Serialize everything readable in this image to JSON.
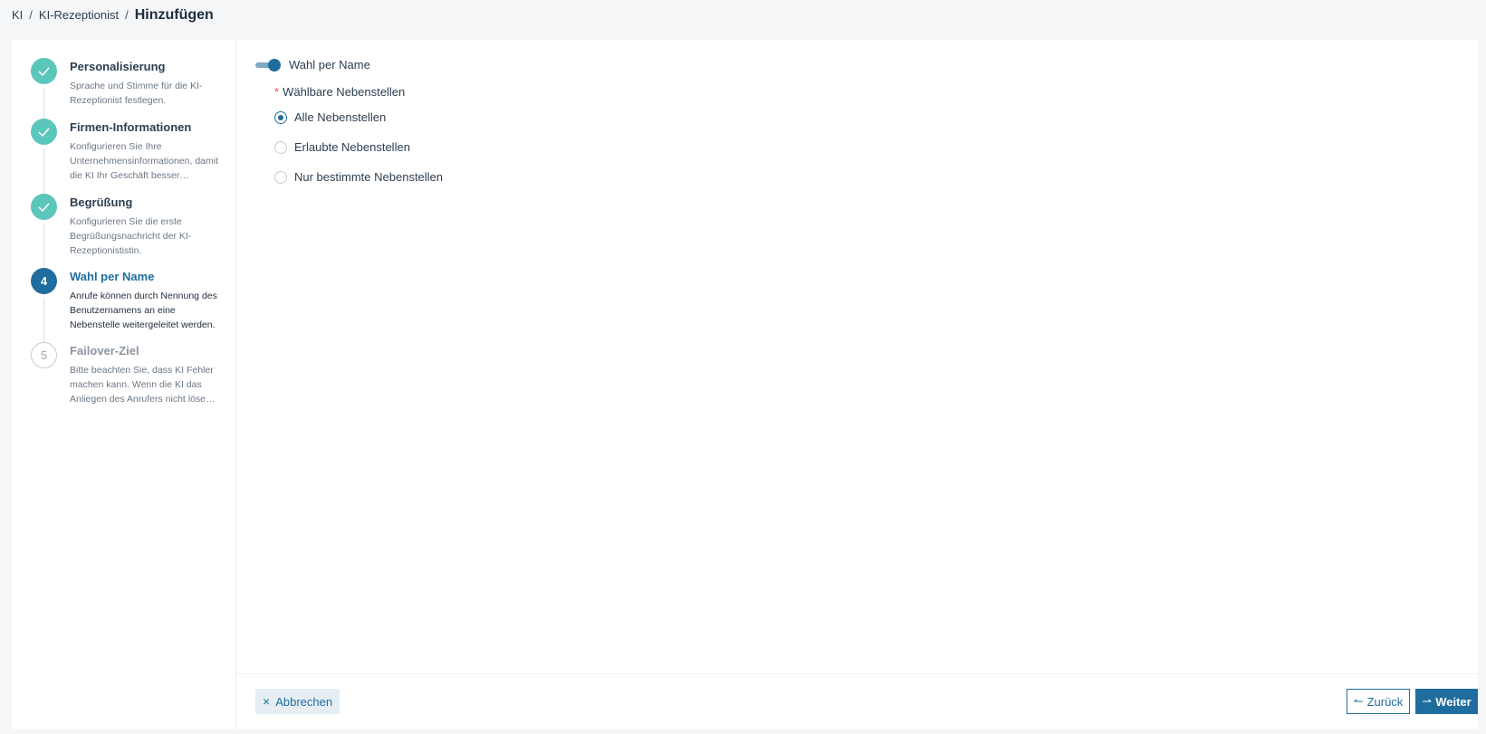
{
  "breadcrumb": {
    "items": [
      "KI",
      "KI-Rezeptionist"
    ],
    "separator": "/",
    "current": "Hinzufügen"
  },
  "steps": [
    {
      "number": "1",
      "status": "done",
      "title": "Personalisierung",
      "description": "Sprache und Stimme für die KI-Rezeptionist festlegen."
    },
    {
      "number": "2",
      "status": "done",
      "title": "Firmen-Informationen",
      "description": "Konfigurieren Sie Ihre Unternehmensinformationen, damit die KI Ihr Geschäft besser…"
    },
    {
      "number": "3",
      "status": "done",
      "title": "Begrüßung",
      "description": "Konfigurieren Sie die erste Begrüßungsnachricht der KI-Rezeptionististin."
    },
    {
      "number": "4",
      "status": "active",
      "title": "Wahl per Name",
      "description": "Anrufe können durch Nennung des Benutzernamens an eine Nebenstelle weitergeleitet werden."
    },
    {
      "number": "5",
      "status": "todo",
      "title": "Failover-Ziel",
      "description": "Bitte beachten Sie, dass KI Fehler machen kann. Wenn die KI das Anliegen des Anrufers nicht löse…"
    }
  ],
  "form": {
    "toggle_label": "Wahl per Name",
    "toggle_on": true,
    "required_mark": "*",
    "field_label": "Wählbare Nebenstellen",
    "options": [
      {
        "label": "Alle Nebenstellen",
        "checked": true
      },
      {
        "label": "Erlaubte Nebenstellen",
        "checked": false
      },
      {
        "label": "Nur bestimmte Nebenstellen",
        "checked": false
      }
    ]
  },
  "footer": {
    "cancel_icon": "×",
    "cancel_label": "Abbrechen",
    "back_icon": "↼",
    "back_label": "Zurück",
    "next_icon": "⇀",
    "next_label": "Weiter"
  },
  "colors": {
    "accent": "#1e6d9e",
    "done": "#5bc6bb",
    "required": "#e05a4b"
  }
}
